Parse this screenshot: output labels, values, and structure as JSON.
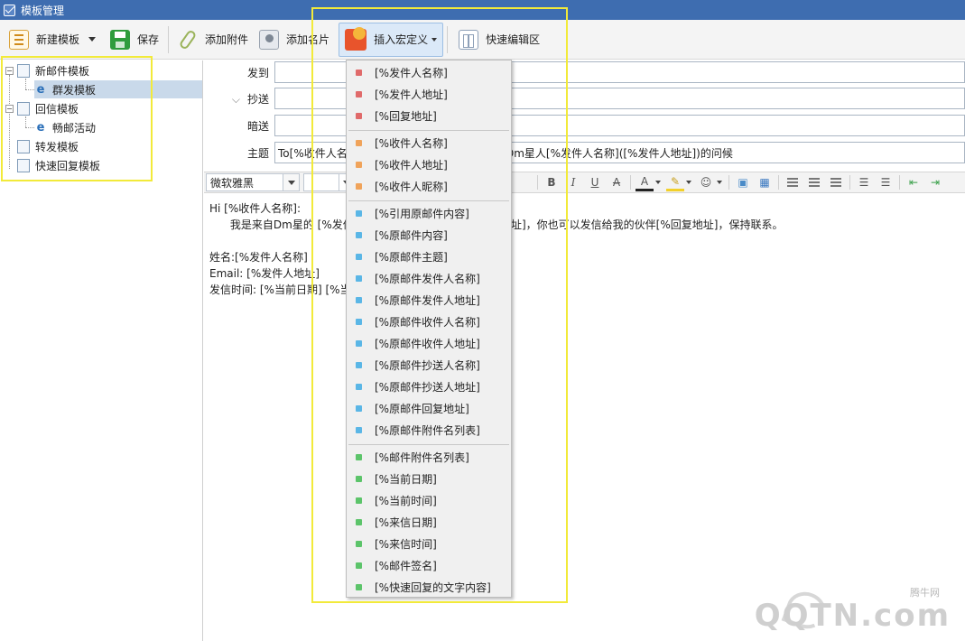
{
  "window": {
    "title": "模板管理"
  },
  "toolbar": {
    "new_template": "新建模板",
    "save": "保存",
    "add_attachment": "添加附件",
    "add_card": "添加名片",
    "insert_macro": "插入宏定义",
    "quick_edit": "快速编辑区"
  },
  "tree": {
    "items": [
      {
        "label": "新邮件模板"
      },
      {
        "label": "群发模板"
      },
      {
        "label": "回信模板"
      },
      {
        "label": "畅邮活动"
      },
      {
        "label": "转发模板"
      },
      {
        "label": "快速回复模板"
      }
    ]
  },
  "form": {
    "to_label": "发到",
    "cc_label": "抄送",
    "bcc_label": "暗送",
    "subject_label": "主题",
    "subject_value": "To[%收件人名称]，我是来自Dm星的Dm星人[%发件人名称]([%发件人地址])的问候",
    "subject_left": "To[%收件人名",
    "subject_right": "Dm星人[%发件人名称]([%发件人地址])的问候"
  },
  "format": {
    "font": "微软雅黑"
  },
  "editor": {
    "lines": [
      "Hi [%收件人名称]:",
      "      我是来自Dm星的 [%发件",
      "",
      "姓名:[%发件人名称]",
      "Email: [%发件人地址]",
      "发信时间: [%当前日期] [%当"
    ],
    "line2_tail": "址]，你也可以发信给我的伙伴[%回复地址]，保持联系。"
  },
  "macro_menu": {
    "groups": [
      {
        "color": "#e06a6a",
        "items": [
          "[%发件人名称]",
          "[%发件人地址]",
          "[%回复地址]"
        ]
      },
      {
        "color": "#f0a35a",
        "items": [
          "[%收件人名称]",
          "[%收件人地址]",
          "[%收件人昵称]"
        ]
      },
      {
        "color": "#5ab6e6",
        "items": [
          "[%引用原邮件内容]",
          "[%原邮件内容]",
          "[%原邮件主题]",
          "[%原邮件发件人名称]",
          "[%原邮件发件人地址]",
          "[%原邮件收件人名称]",
          "[%原邮件收件人地址]",
          "[%原邮件抄送人名称]",
          "[%原邮件抄送人地址]",
          "[%原邮件回复地址]",
          "[%原邮件附件名列表]"
        ]
      },
      {
        "color": "#5cc46a",
        "items": [
          "[%邮件附件名列表]",
          "[%当前日期]",
          "[%当前时间]",
          "[%来信日期]",
          "[%来信时间]",
          "[%邮件签名]",
          "[%快速回复的文字内容]"
        ]
      }
    ]
  },
  "watermark": {
    "small": "腾牛网",
    "big": "QQTN.com"
  }
}
